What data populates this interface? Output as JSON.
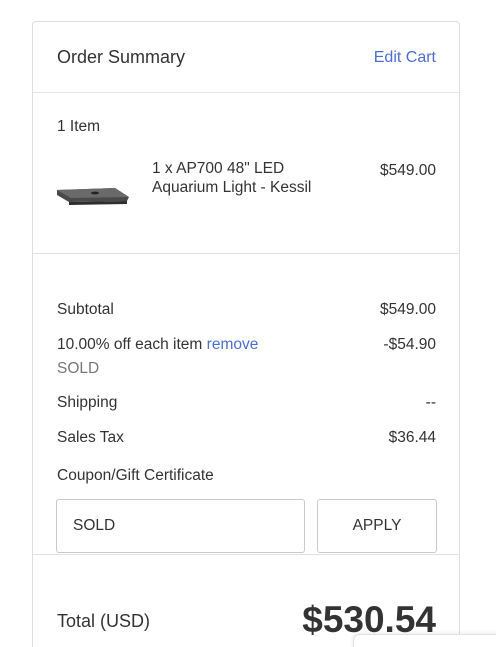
{
  "summary": {
    "title": "Order Summary",
    "edit_cart": "Edit Cart"
  },
  "items": {
    "count_label": "1 Item",
    "list": [
      {
        "name": "1 x AP700 48\" LED Aquarium Light - Kessil",
        "price": "$549.00",
        "image_icon": "aquarium-light-icon"
      }
    ]
  },
  "totals": {
    "subtotal_label": "Subtotal",
    "subtotal_value": "$549.00",
    "discount_label": "10.00% off each item",
    "discount_remove": "remove",
    "discount_value": "-$54.90",
    "discount_code": "SOLD",
    "shipping_label": "Shipping",
    "shipping_value": "--",
    "tax_label": "Sales Tax",
    "tax_value": "$36.44",
    "coupon_label": "Coupon/Gift Certificate",
    "coupon_value": "SOLD",
    "apply_label": "APPLY"
  },
  "grand_total": {
    "label": "Total (USD)",
    "value": "$530.54"
  },
  "colors": {
    "link": "#4a6fd0",
    "text": "#333333",
    "border": "#dddddd"
  }
}
